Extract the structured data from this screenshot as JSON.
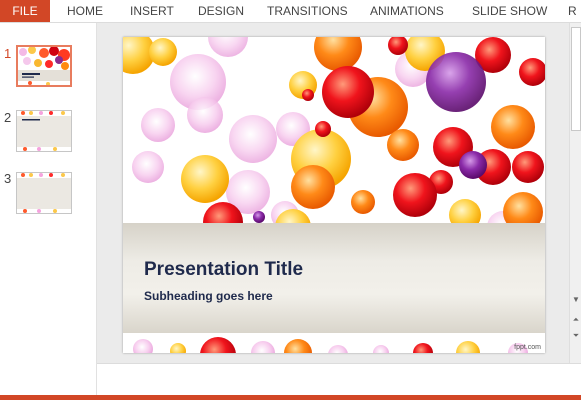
{
  "ribbon": {
    "tabs": [
      "FILE",
      "HOME",
      "INSERT",
      "DESIGN",
      "TRANSITIONS",
      "ANIMATIONS",
      "SLIDE SHOW",
      "R"
    ]
  },
  "thumbnails": {
    "numbers": [
      "1",
      "2",
      "3"
    ],
    "selected": "1"
  },
  "slide": {
    "title": "Presentation Title",
    "subtitle": "Subheading goes here",
    "credit": "fppt.com"
  },
  "colors": {
    "accent": "#d24726",
    "selection": "#e87c5e",
    "title_text": "#1f2a4c"
  },
  "icons": {
    "scroll_down": "scroll-down-arrow-icon",
    "prev_slide": "previous-slide-icon",
    "next_slide": "next-slide-icon"
  }
}
